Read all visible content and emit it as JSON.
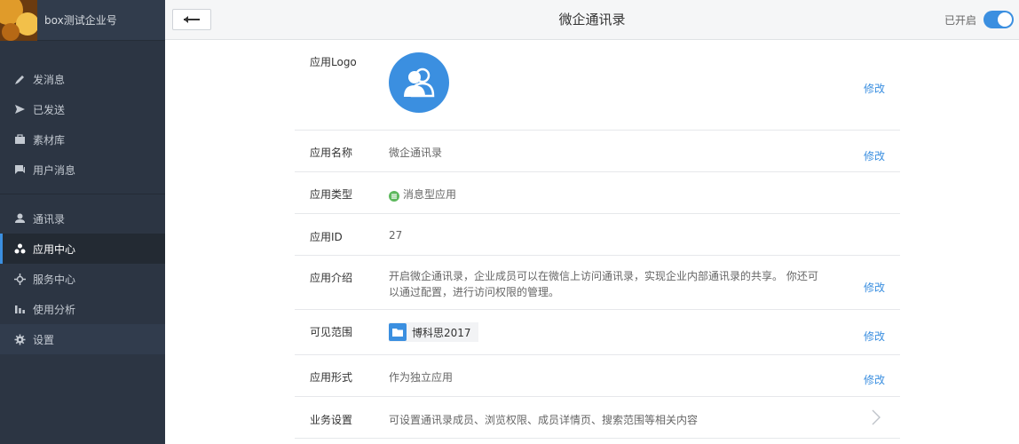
{
  "sidebar": {
    "corp_name": "box测试企业号",
    "groups": [
      [
        {
          "label": "发消息",
          "icon": "pencil-icon"
        },
        {
          "label": "已发送",
          "icon": "send-icon"
        },
        {
          "label": "素材库",
          "icon": "briefcase-icon"
        },
        {
          "label": "用户消息",
          "icon": "chat-icon"
        }
      ],
      [
        {
          "label": "通讯录",
          "icon": "person-icon"
        },
        {
          "label": "应用中心",
          "icon": "app-cluster-icon",
          "active": true
        },
        {
          "label": "服务中心",
          "icon": "service-icon"
        },
        {
          "label": "使用分析",
          "icon": "bar-chart-icon"
        },
        {
          "label": "设置",
          "icon": "gear-icon"
        }
      ]
    ]
  },
  "topbar": {
    "title": "微企通讯录",
    "enable_label": "已开启",
    "enabled": true
  },
  "detail": {
    "edit_label": "修改",
    "logo": {
      "label": "应用Logo"
    },
    "name": {
      "label": "应用名称",
      "value": "微企通讯录"
    },
    "type": {
      "label": "应用类型",
      "value": "消息型应用"
    },
    "id": {
      "label": "应用ID",
      "value": "27"
    },
    "intro": {
      "label": "应用介绍",
      "value": "开启微企通讯录，企业成员可以在微信上访问通讯录，实现企业内部通讯录的共享。 你还可以通过配置，进行访问权限的管理。"
    },
    "scope": {
      "label": "可见范围",
      "value": "博科思2017"
    },
    "form": {
      "label": "应用形式",
      "value": "作为独立应用"
    },
    "business": {
      "label": "业务设置",
      "value": "可设置通讯录成员、浏览权限、成员详情页、搜索范围等相关内容"
    }
  },
  "colors": {
    "accent": "#3b8fe0",
    "sidebar_bg": "#2c3543",
    "type_badge": "#5cb85c"
  }
}
